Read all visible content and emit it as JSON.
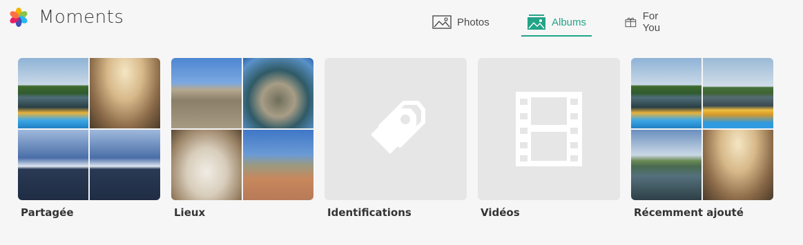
{
  "app": {
    "title": "Moments"
  },
  "tabs": [
    {
      "label": "Photos",
      "icon": "image-icon",
      "active": false
    },
    {
      "label": "Albums",
      "icon": "album-icon",
      "active": true
    },
    {
      "label": "For You",
      "icon": "gift-icon",
      "active": false
    }
  ],
  "albums": [
    {
      "label": "Partagée",
      "type": "grid"
    },
    {
      "label": "Lieux",
      "type": "grid"
    },
    {
      "label": "Identifications",
      "type": "empty",
      "icon": "tag-icon"
    },
    {
      "label": "Vidéos",
      "type": "empty",
      "icon": "film-icon"
    },
    {
      "label": "Récemment ajouté",
      "type": "grid"
    }
  ],
  "colors": {
    "accent": "#23a387",
    "background": "#f6f6f6",
    "placeholder": "#e6e6e6"
  }
}
